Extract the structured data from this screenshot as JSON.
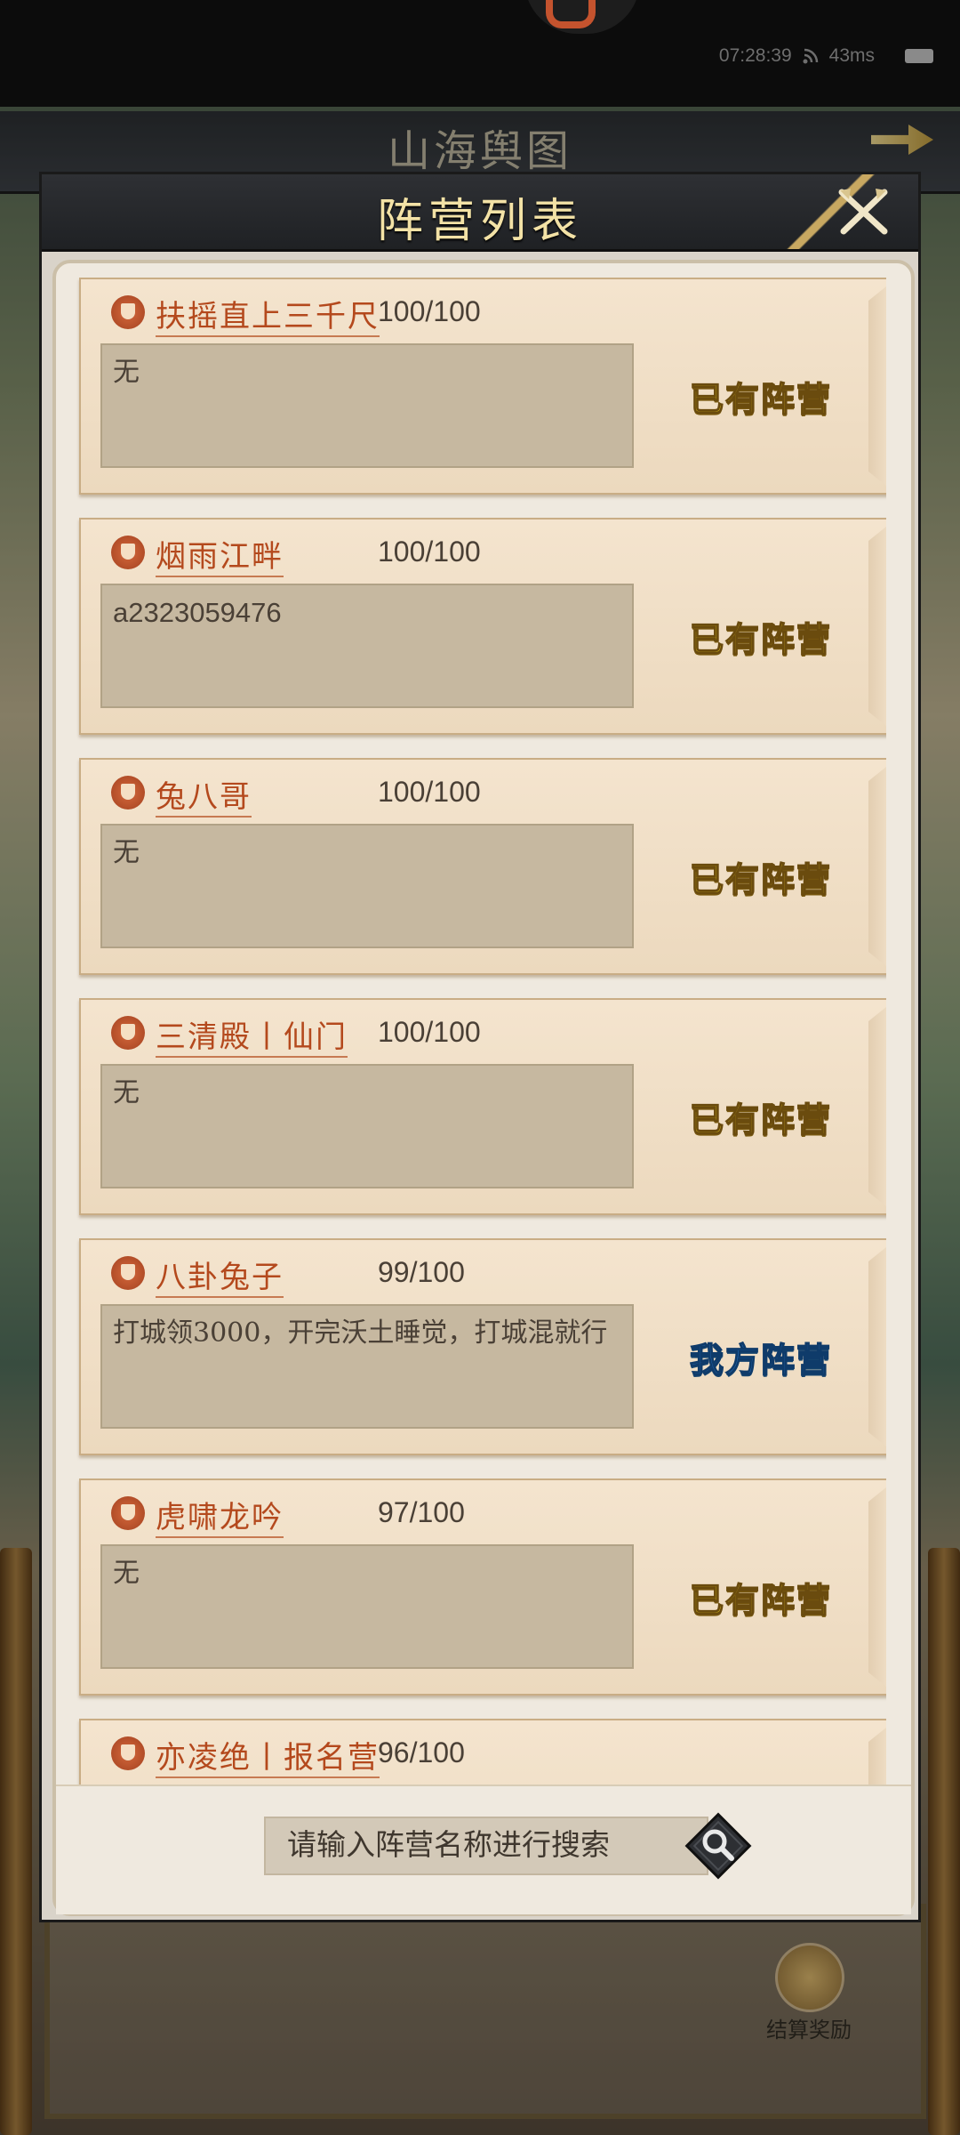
{
  "status_bar": {
    "time": "07:28:39",
    "ping": "43ms"
  },
  "background": {
    "map_title": "山海舆图",
    "reward_label": "结算奖励"
  },
  "dialog": {
    "title": "阵营列表",
    "close_icon": "crossed-swords-icon",
    "factions": [
      {
        "name": "扶摇直上三千尺",
        "count": "100/100",
        "notice": "无",
        "status": "已有阵营",
        "status_kind": "has"
      },
      {
        "name": "烟雨江畔",
        "count": "100/100",
        "notice": "a2323059476",
        "status": "已有阵营",
        "status_kind": "has"
      },
      {
        "name": "兔八哥",
        "count": "100/100",
        "notice": "无",
        "status": "已有阵营",
        "status_kind": "has"
      },
      {
        "name": "三清殿丨仙门",
        "count": "100/100",
        "notice": "无",
        "status": "已有阵营",
        "status_kind": "has"
      },
      {
        "name": "八卦兔子",
        "count": "99/100",
        "notice": "打城领3000，开完沃土睡觉，打城混就行",
        "status": "我方阵营",
        "status_kind": "ours"
      },
      {
        "name": "虎啸龙吟",
        "count": "97/100",
        "notice": "无",
        "status": "已有阵营",
        "status_kind": "has"
      },
      {
        "name": "亦凌绝丨报名营",
        "count": "96/100",
        "notice": "",
        "status": "",
        "status_kind": "has"
      }
    ],
    "search": {
      "placeholder": "请输入阵营名称进行搜索",
      "button_icon": "magnifier-icon"
    }
  },
  "colors": {
    "status_has": "#f1d21a",
    "status_ours": "#2c7fd6",
    "faction_name": "#b4491d"
  }
}
